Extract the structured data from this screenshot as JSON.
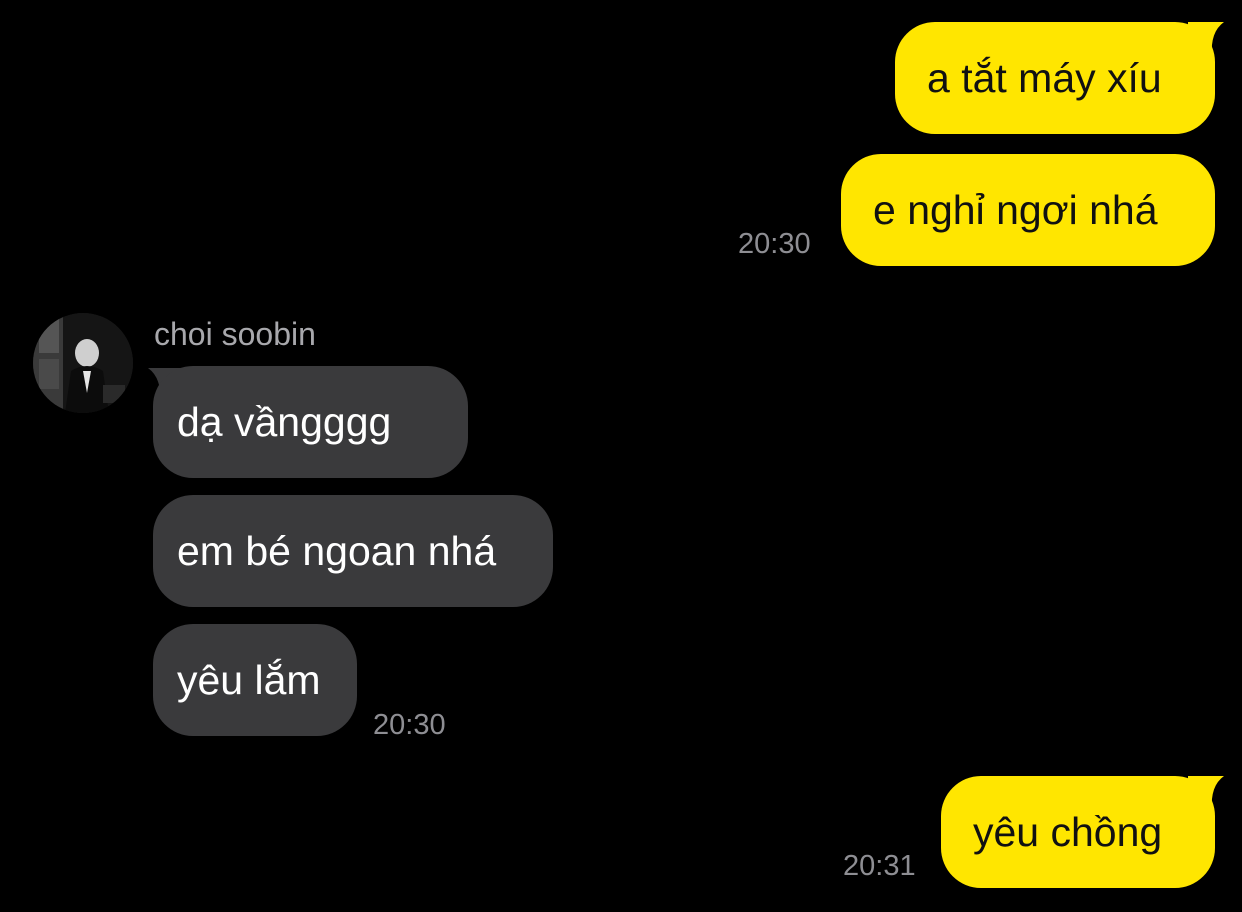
{
  "colors": {
    "background": "#000000",
    "outgoing_bubble": "#FFE600",
    "incoming_bubble": "#3A3A3C",
    "timestamp": "#8E8E93",
    "sender_name": "#A8A8AC"
  },
  "chat": {
    "block1": {
      "messages": [
        {
          "text": "a tắt máy xíu"
        },
        {
          "text": "e nghỉ ngơi nhá"
        }
      ],
      "time": "20:30"
    },
    "block2": {
      "sender": "choi soobin",
      "avatar_icon": "profile-photo-avatar",
      "messages": [
        {
          "text": "dạ vầngggg"
        },
        {
          "text": "em bé ngoan nhá"
        },
        {
          "text": "yêu lắm"
        }
      ],
      "time": "20:30"
    },
    "block3": {
      "messages": [
        {
          "text": "yêu chồng"
        }
      ],
      "time": "20:31"
    }
  }
}
